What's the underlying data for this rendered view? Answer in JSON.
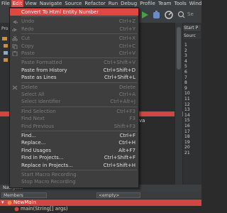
{
  "menubar": {
    "items": [
      "File",
      "Edit",
      "View",
      "Navigate",
      "Source",
      "Refactor",
      "Run",
      "Debug",
      "Profile",
      "Team",
      "Tools",
      "Wind"
    ]
  },
  "toolbar": {
    "search_hint": "Se"
  },
  "left_panel": {
    "label": "Pro"
  },
  "right_panel": {
    "tab1": "Start P",
    "tab2": "Sourc"
  },
  "line_numbers": [
    "1",
    "2",
    "3",
    "4",
    "5",
    "6",
    "7",
    "8",
    "9",
    "10",
    "11",
    "12",
    "13",
    "14",
    "15",
    "16",
    "17",
    "18",
    "19",
    "20",
    "21"
  ],
  "editor_fragment": "va",
  "edit_menu": {
    "items": [
      {
        "label": "Convert To Html Entity Number",
        "shortcut": "",
        "state": "hl",
        "icon": ""
      },
      {
        "label": "Undo",
        "shortcut": "Ctrl+Z",
        "state": "dis",
        "icon": "undo-icon"
      },
      {
        "label": "Redo",
        "shortcut": "Ctrl+Y",
        "state": "dis",
        "icon": "redo-icon"
      },
      {
        "label": "Cut",
        "shortcut": "Ctrl+X",
        "state": "dis",
        "icon": "cut-icon"
      },
      {
        "label": "Copy",
        "shortcut": "Ctrl+C",
        "state": "dis",
        "icon": "copy-icon"
      },
      {
        "label": "Paste",
        "shortcut": "Ctrl+V",
        "state": "dis",
        "icon": "paste-icon"
      },
      {
        "label": "Paste Formatted",
        "shortcut": "Ctrl+Shift+V",
        "state": "dis",
        "icon": ""
      },
      {
        "label": "Paste from History",
        "shortcut": "Ctrl+Shift+D",
        "state": "en",
        "icon": ""
      },
      {
        "label": "Paste as Lines",
        "shortcut": "Ctrl+Shift+L",
        "state": "en",
        "icon": ""
      },
      {
        "label": "Delete",
        "shortcut": "Delete",
        "state": "dis",
        "icon": "delete-icon"
      },
      {
        "label": "Select All",
        "shortcut": "Ctrl+A",
        "state": "dis",
        "icon": ""
      },
      {
        "label": "Select Identifier",
        "shortcut": "Ctrl+Alt+J",
        "state": "dis",
        "icon": ""
      },
      {
        "label": "Find Selection",
        "shortcut": "Ctrl+F3",
        "state": "dis",
        "icon": ""
      },
      {
        "label": "Find Next",
        "shortcut": "F3",
        "state": "dis",
        "icon": ""
      },
      {
        "label": "Find Previous",
        "shortcut": "Shift+F3",
        "state": "dis",
        "icon": ""
      },
      {
        "label": "Find...",
        "shortcut": "Ctrl+F",
        "state": "en",
        "icon": ""
      },
      {
        "label": "Replace...",
        "shortcut": "Ctrl+H",
        "state": "en",
        "icon": ""
      },
      {
        "label": "Find Usages",
        "shortcut": "Alt+F7",
        "state": "en",
        "icon": ""
      },
      {
        "label": "Find in Projects...",
        "shortcut": "Ctrl+Shift+F",
        "state": "en",
        "icon": ""
      },
      {
        "label": "Replace in Projects...",
        "shortcut": "Ctrl+Shift+H",
        "state": "en",
        "icon": ""
      },
      {
        "label": "Start Macro Recording",
        "shortcut": "",
        "state": "dis",
        "icon": ""
      },
      {
        "label": "Stop Macro Recording",
        "shortcut": "",
        "state": "dis",
        "icon": ""
      }
    ]
  },
  "bottom": {
    "tab": "Navigator",
    "members_label": "Members",
    "combo_value": "<empty>",
    "tree_root": "NewMain",
    "tree_child": "main(String[] args)"
  }
}
